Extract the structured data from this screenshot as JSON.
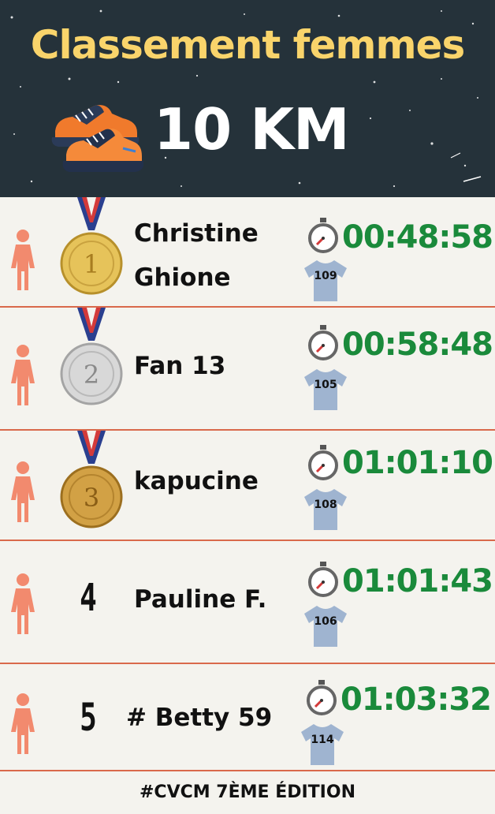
{
  "header": {
    "title": "Classement femmes",
    "distance": "10 KM"
  },
  "colors": {
    "header_bg": "#25323a",
    "title": "#f9d46b",
    "time": "#1a8a3b",
    "divider": "#d9694b",
    "woman_icon": "#f28a6e",
    "shirt": "#9fb4d0"
  },
  "results": [
    {
      "rank": "1",
      "medal": "gold",
      "name_line1": "Christine",
      "name_line2": "Ghione",
      "time": "00:48:58",
      "bib": "109"
    },
    {
      "rank": "2",
      "medal": "silver",
      "name_line1": "Fan 13",
      "name_line2": "",
      "time": "00:58:48",
      "bib": "105"
    },
    {
      "rank": "3",
      "medal": "bronze",
      "name_line1": "kapucine",
      "name_line2": "",
      "time": "01:01:10",
      "bib": "108"
    },
    {
      "rank": "4",
      "medal": "none",
      "name_line1": "Pauline F.",
      "name_line2": "",
      "time": "01:01:43",
      "bib": "106"
    },
    {
      "rank": "5",
      "medal": "none",
      "name_line1": "# Betty 59",
      "name_line2": "",
      "time": "01:03:32",
      "bib": "114"
    }
  ],
  "footer": {
    "hashtag": "#CVCM 7ÈME ÉDITION"
  }
}
